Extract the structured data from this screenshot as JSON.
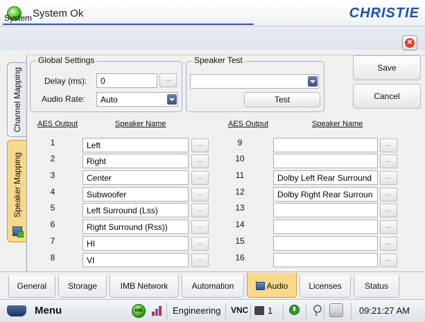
{
  "header": {
    "status_text": "System Ok",
    "brand": "CHRISTIE"
  },
  "system": {
    "title": "System"
  },
  "side_tabs": {
    "channel_mapping": "Channel Mapping",
    "speaker_mapping": "Speaker Mapping"
  },
  "global_settings": {
    "title": "Global Settings",
    "delay_label": "Delay (ms):",
    "delay_value": "0",
    "audio_rate_label": "Audio Rate:",
    "audio_rate_value": "Auto"
  },
  "speaker_test": {
    "title": "Speaker Test",
    "selected": "",
    "test_label": "Test"
  },
  "actions": {
    "save_label": "Save",
    "cancel_label": "Cancel"
  },
  "table": {
    "col_aes_output": "AES Output",
    "col_speaker_name": "Speaker Name",
    "ellipsis": "...",
    "rows": [
      {
        "n": "1",
        "name": "Left"
      },
      {
        "n": "2",
        "name": "Right"
      },
      {
        "n": "3",
        "name": "Center"
      },
      {
        "n": "4",
        "name": "Subwoofer"
      },
      {
        "n": "5",
        "name": "Left Surround (Lss)"
      },
      {
        "n": "6",
        "name": "Right Surround (Rss))"
      },
      {
        "n": "7",
        "name": "HI"
      },
      {
        "n": "8",
        "name": "VI"
      },
      {
        "n": "9",
        "name": ""
      },
      {
        "n": "10",
        "name": ""
      },
      {
        "n": "11",
        "name": "Dolby Left Rear Surround"
      },
      {
        "n": "12",
        "name": "Dolby Right Rear Surroun"
      },
      {
        "n": "13",
        "name": ""
      },
      {
        "n": "14",
        "name": ""
      },
      {
        "n": "15",
        "name": ""
      },
      {
        "n": "16",
        "name": ""
      }
    ]
  },
  "bottom_tabs": [
    "General",
    "Storage",
    "IMB Network",
    "Automation",
    "Audio",
    "Licenses",
    "Status"
  ],
  "taskbar": {
    "menu_label": "Menu",
    "imb_label": "IMB",
    "user_role": "Engineering",
    "vnc_label": "VNC",
    "camera_count": "1",
    "time": "09:21:27 AM"
  },
  "colors": {
    "brand_blue": "#1f4fa8",
    "active_tab": "#f7d98b",
    "status_green": "#3fbf1a",
    "close_red": "#e2402a"
  }
}
